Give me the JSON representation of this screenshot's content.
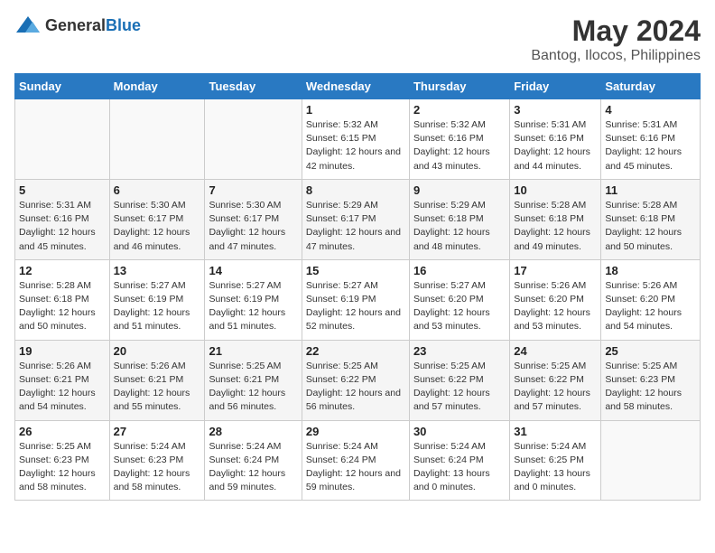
{
  "header": {
    "logo_general": "General",
    "logo_blue": "Blue",
    "main_title": "May 2024",
    "subtitle": "Bantog, Ilocos, Philippines"
  },
  "calendar": {
    "days_of_week": [
      "Sunday",
      "Monday",
      "Tuesday",
      "Wednesday",
      "Thursday",
      "Friday",
      "Saturday"
    ],
    "weeks": [
      [
        {
          "day": "",
          "sunrise": "",
          "sunset": "",
          "daylight": ""
        },
        {
          "day": "",
          "sunrise": "",
          "sunset": "",
          "daylight": ""
        },
        {
          "day": "",
          "sunrise": "",
          "sunset": "",
          "daylight": ""
        },
        {
          "day": "1",
          "sunrise": "Sunrise: 5:32 AM",
          "sunset": "Sunset: 6:15 PM",
          "daylight": "Daylight: 12 hours and 42 minutes."
        },
        {
          "day": "2",
          "sunrise": "Sunrise: 5:32 AM",
          "sunset": "Sunset: 6:16 PM",
          "daylight": "Daylight: 12 hours and 43 minutes."
        },
        {
          "day": "3",
          "sunrise": "Sunrise: 5:31 AM",
          "sunset": "Sunset: 6:16 PM",
          "daylight": "Daylight: 12 hours and 44 minutes."
        },
        {
          "day": "4",
          "sunrise": "Sunrise: 5:31 AM",
          "sunset": "Sunset: 6:16 PM",
          "daylight": "Daylight: 12 hours and 45 minutes."
        }
      ],
      [
        {
          "day": "5",
          "sunrise": "Sunrise: 5:31 AM",
          "sunset": "Sunset: 6:16 PM",
          "daylight": "Daylight: 12 hours and 45 minutes."
        },
        {
          "day": "6",
          "sunrise": "Sunrise: 5:30 AM",
          "sunset": "Sunset: 6:17 PM",
          "daylight": "Daylight: 12 hours and 46 minutes."
        },
        {
          "day": "7",
          "sunrise": "Sunrise: 5:30 AM",
          "sunset": "Sunset: 6:17 PM",
          "daylight": "Daylight: 12 hours and 47 minutes."
        },
        {
          "day": "8",
          "sunrise": "Sunrise: 5:29 AM",
          "sunset": "Sunset: 6:17 PM",
          "daylight": "Daylight: 12 hours and 47 minutes."
        },
        {
          "day": "9",
          "sunrise": "Sunrise: 5:29 AM",
          "sunset": "Sunset: 6:18 PM",
          "daylight": "Daylight: 12 hours and 48 minutes."
        },
        {
          "day": "10",
          "sunrise": "Sunrise: 5:28 AM",
          "sunset": "Sunset: 6:18 PM",
          "daylight": "Daylight: 12 hours and 49 minutes."
        },
        {
          "day": "11",
          "sunrise": "Sunrise: 5:28 AM",
          "sunset": "Sunset: 6:18 PM",
          "daylight": "Daylight: 12 hours and 50 minutes."
        }
      ],
      [
        {
          "day": "12",
          "sunrise": "Sunrise: 5:28 AM",
          "sunset": "Sunset: 6:18 PM",
          "daylight": "Daylight: 12 hours and 50 minutes."
        },
        {
          "day": "13",
          "sunrise": "Sunrise: 5:27 AM",
          "sunset": "Sunset: 6:19 PM",
          "daylight": "Daylight: 12 hours and 51 minutes."
        },
        {
          "day": "14",
          "sunrise": "Sunrise: 5:27 AM",
          "sunset": "Sunset: 6:19 PM",
          "daylight": "Daylight: 12 hours and 51 minutes."
        },
        {
          "day": "15",
          "sunrise": "Sunrise: 5:27 AM",
          "sunset": "Sunset: 6:19 PM",
          "daylight": "Daylight: 12 hours and 52 minutes."
        },
        {
          "day": "16",
          "sunrise": "Sunrise: 5:27 AM",
          "sunset": "Sunset: 6:20 PM",
          "daylight": "Daylight: 12 hours and 53 minutes."
        },
        {
          "day": "17",
          "sunrise": "Sunrise: 5:26 AM",
          "sunset": "Sunset: 6:20 PM",
          "daylight": "Daylight: 12 hours and 53 minutes."
        },
        {
          "day": "18",
          "sunrise": "Sunrise: 5:26 AM",
          "sunset": "Sunset: 6:20 PM",
          "daylight": "Daylight: 12 hours and 54 minutes."
        }
      ],
      [
        {
          "day": "19",
          "sunrise": "Sunrise: 5:26 AM",
          "sunset": "Sunset: 6:21 PM",
          "daylight": "Daylight: 12 hours and 54 minutes."
        },
        {
          "day": "20",
          "sunrise": "Sunrise: 5:26 AM",
          "sunset": "Sunset: 6:21 PM",
          "daylight": "Daylight: 12 hours and 55 minutes."
        },
        {
          "day": "21",
          "sunrise": "Sunrise: 5:25 AM",
          "sunset": "Sunset: 6:21 PM",
          "daylight": "Daylight: 12 hours and 56 minutes."
        },
        {
          "day": "22",
          "sunrise": "Sunrise: 5:25 AM",
          "sunset": "Sunset: 6:22 PM",
          "daylight": "Daylight: 12 hours and 56 minutes."
        },
        {
          "day": "23",
          "sunrise": "Sunrise: 5:25 AM",
          "sunset": "Sunset: 6:22 PM",
          "daylight": "Daylight: 12 hours and 57 minutes."
        },
        {
          "day": "24",
          "sunrise": "Sunrise: 5:25 AM",
          "sunset": "Sunset: 6:22 PM",
          "daylight": "Daylight: 12 hours and 57 minutes."
        },
        {
          "day": "25",
          "sunrise": "Sunrise: 5:25 AM",
          "sunset": "Sunset: 6:23 PM",
          "daylight": "Daylight: 12 hours and 58 minutes."
        }
      ],
      [
        {
          "day": "26",
          "sunrise": "Sunrise: 5:25 AM",
          "sunset": "Sunset: 6:23 PM",
          "daylight": "Daylight: 12 hours and 58 minutes."
        },
        {
          "day": "27",
          "sunrise": "Sunrise: 5:24 AM",
          "sunset": "Sunset: 6:23 PM",
          "daylight": "Daylight: 12 hours and 58 minutes."
        },
        {
          "day": "28",
          "sunrise": "Sunrise: 5:24 AM",
          "sunset": "Sunset: 6:24 PM",
          "daylight": "Daylight: 12 hours and 59 minutes."
        },
        {
          "day": "29",
          "sunrise": "Sunrise: 5:24 AM",
          "sunset": "Sunset: 6:24 PM",
          "daylight": "Daylight: 12 hours and 59 minutes."
        },
        {
          "day": "30",
          "sunrise": "Sunrise: 5:24 AM",
          "sunset": "Sunset: 6:24 PM",
          "daylight": "Daylight: 13 hours and 0 minutes."
        },
        {
          "day": "31",
          "sunrise": "Sunrise: 5:24 AM",
          "sunset": "Sunset: 6:25 PM",
          "daylight": "Daylight: 13 hours and 0 minutes."
        },
        {
          "day": "",
          "sunrise": "",
          "sunset": "",
          "daylight": ""
        }
      ]
    ]
  }
}
